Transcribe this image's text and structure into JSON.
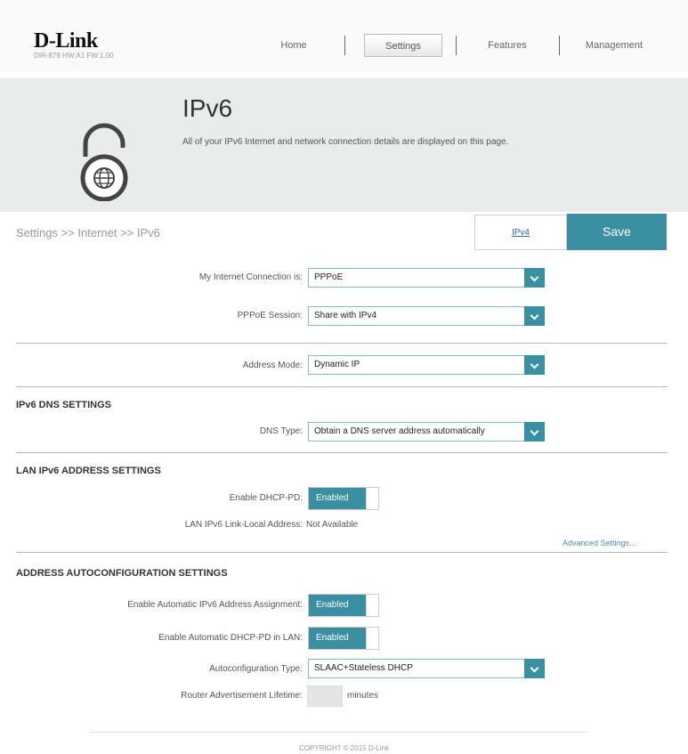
{
  "brand": {
    "logo": "D-Link",
    "model": "DIR-879 HW:A1 FW:1.00"
  },
  "nav": {
    "home": "Home",
    "settings": "Settings",
    "features": "Features",
    "management": "Management"
  },
  "hero": {
    "title": "IPv6",
    "description": "All of your IPv6 Internet and network connection details are displayed on this page."
  },
  "breadcrumb": "Settings >> Internet >> IPv6",
  "tabs": {
    "ipv4": "IPv4",
    "save": "Save"
  },
  "connection": {
    "my_internet_label": "My Internet Connection is:",
    "my_internet_value": "PPPoE",
    "pppoe_session_label": "PPPoE Session:",
    "pppoe_session_value": "Share with IPv4",
    "address_mode_label": "Address Mode:",
    "address_mode_value": "Dynamic IP"
  },
  "dns": {
    "heading": "IPv6 DNS SETTINGS",
    "type_label": "DNS Type:",
    "type_value": "Obtain a DNS server address automatically"
  },
  "lan": {
    "heading": "LAN IPv6 ADDRESS SETTINGS",
    "dhcp_pd_label": "Enable DHCP-PD:",
    "dhcp_pd_value": "Enabled",
    "link_local_label": "LAN IPv6 Link-Local Address:",
    "link_local_value": "Not Available",
    "advanced_link": "Advanced Settings..."
  },
  "autoconfig": {
    "heading": "ADDRESS AUTOCONFIGURATION SETTINGS",
    "auto_assign_label": "Enable Automatic IPv6 Address Assignment:",
    "auto_assign_value": "Enabled",
    "auto_dhcp_pd_label": "Enable Automatic DHCP-PD in LAN:",
    "auto_dhcp_pd_value": "Enabled",
    "type_label": "Autoconfiguration Type:",
    "type_value": "SLAAC+Stateless DHCP",
    "lifetime_label": "Router Advertisement Lifetime:",
    "lifetime_value": "",
    "lifetime_unit": "minutes"
  },
  "footer": {
    "copyright": "COPYRIGHT © 2015 D-Link"
  },
  "colors": {
    "accent": "#3a8fa3",
    "link": "#2a6aa4",
    "hero_bg": "#e9eced"
  },
  "icons": {
    "hero": "globe-padlock-icon",
    "dropdown": "chevron-down-icon"
  }
}
